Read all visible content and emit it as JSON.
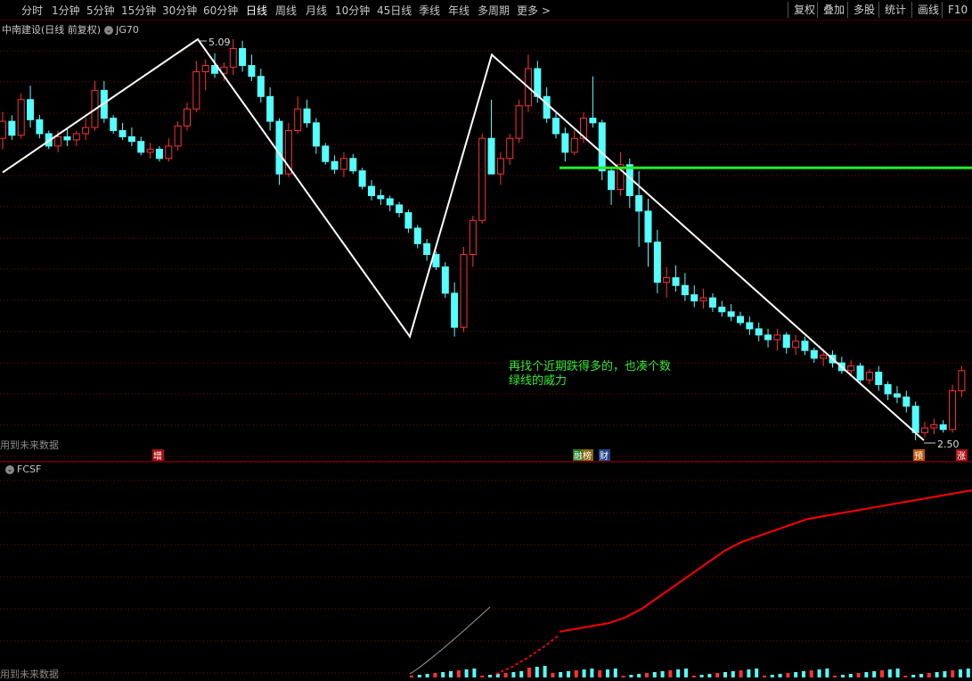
{
  "toolbar": {
    "periods": [
      "分时",
      "1分钟",
      "5分钟",
      "15分钟",
      "30分钟",
      "60分钟",
      "日线",
      "周线",
      "月线",
      "10分钟",
      "45日线",
      "季线",
      "年线",
      "多周期",
      "更多 >"
    ],
    "active_period": "日线",
    "right_buttons": [
      "复权",
      "叠加",
      "多股",
      "统计",
      "画线",
      "F10"
    ]
  },
  "main_chart": {
    "title": "中南建设(日线 前复权)",
    "indicator": "JG70",
    "high_label": "5.09",
    "low_label": "2.50",
    "future_text": "用到未来数据",
    "annotation_line1": "再找个近期跌得多的，也凑个数",
    "annotation_line2": "绿线的威力",
    "event_markers": [
      "增",
      "融",
      "榜",
      "财",
      "预",
      "涨"
    ]
  },
  "indicator_panel": {
    "title": "FCSF",
    "future_text": "用到未来数据"
  },
  "colors": {
    "up": "#ff3232",
    "down": "#54ffff",
    "zigzag": "#ffffff",
    "support_line": "#22ee22",
    "fcsf_line": "#ff0000",
    "grid": "#8b0000"
  },
  "chart_data": {
    "type": "candlestick",
    "price_range": [
      2.5,
      5.09
    ],
    "zigzag_pivots": [
      4.23,
      5.09,
      3.17,
      4.99,
      2.5
    ],
    "support_level": 4.26,
    "candles": [
      [
        4.45,
        4.62,
        4.38,
        4.56
      ],
      [
        4.56,
        4.6,
        4.44,
        4.47
      ],
      [
        4.47,
        4.74,
        4.45,
        4.7
      ],
      [
        4.7,
        4.79,
        4.52,
        4.57
      ],
      [
        4.57,
        4.6,
        4.45,
        4.48
      ],
      [
        4.48,
        4.5,
        4.38,
        4.4
      ],
      [
        4.4,
        4.5,
        4.36,
        4.46
      ],
      [
        4.46,
        4.52,
        4.4,
        4.44
      ],
      [
        4.44,
        4.5,
        4.4,
        4.48
      ],
      [
        4.48,
        4.58,
        4.44,
        4.52
      ],
      [
        4.52,
        4.82,
        4.5,
        4.76
      ],
      [
        4.76,
        4.82,
        4.55,
        4.58
      ],
      [
        4.58,
        4.6,
        4.48,
        4.5
      ],
      [
        4.5,
        4.55,
        4.44,
        4.46
      ],
      [
        4.46,
        4.52,
        4.4,
        4.43
      ],
      [
        4.43,
        4.46,
        4.34,
        4.36
      ],
      [
        4.36,
        4.42,
        4.32,
        4.38
      ],
      [
        4.38,
        4.4,
        4.3,
        4.32
      ],
      [
        4.32,
        4.45,
        4.3,
        4.4
      ],
      [
        4.4,
        4.56,
        4.37,
        4.53
      ],
      [
        4.53,
        4.68,
        4.5,
        4.64
      ],
      [
        4.64,
        4.95,
        4.62,
        4.88
      ],
      [
        4.88,
        4.96,
        4.76,
        4.92
      ],
      [
        4.92,
        5.0,
        4.84,
        4.87
      ],
      [
        4.87,
        4.94,
        4.82,
        4.91
      ],
      [
        4.91,
        5.09,
        4.86,
        5.03
      ],
      [
        5.03,
        5.08,
        4.88,
        4.92
      ],
      [
        4.92,
        4.99,
        4.82,
        4.85
      ],
      [
        4.85,
        4.9,
        4.68,
        4.72
      ],
      [
        4.72,
        4.78,
        4.5,
        4.56
      ],
      [
        4.56,
        4.58,
        4.15,
        4.22
      ],
      [
        4.22,
        4.55,
        4.2,
        4.5
      ],
      [
        4.5,
        4.72,
        4.48,
        4.64
      ],
      [
        4.64,
        4.7,
        4.52,
        4.55
      ],
      [
        4.55,
        4.58,
        4.35,
        4.4
      ],
      [
        4.4,
        4.42,
        4.28,
        4.3
      ],
      [
        4.3,
        4.34,
        4.22,
        4.25
      ],
      [
        4.25,
        4.36,
        4.2,
        4.32
      ],
      [
        4.32,
        4.35,
        4.22,
        4.24
      ],
      [
        4.24,
        4.26,
        4.12,
        4.14
      ],
      [
        4.14,
        4.18,
        4.05,
        4.08
      ],
      [
        4.08,
        4.12,
        4.02,
        4.06
      ],
      [
        4.06,
        4.08,
        3.98,
        4.02
      ],
      [
        4.02,
        4.04,
        3.94,
        3.97
      ],
      [
        3.97,
        3.99,
        3.84,
        3.87
      ],
      [
        3.87,
        3.89,
        3.74,
        3.77
      ],
      [
        3.77,
        3.8,
        3.66,
        3.7
      ],
      [
        3.7,
        3.72,
        3.6,
        3.62
      ],
      [
        3.62,
        3.65,
        3.42,
        3.45
      ],
      [
        3.45,
        3.52,
        3.17,
        3.23
      ],
      [
        3.23,
        3.75,
        3.2,
        3.7
      ],
      [
        3.7,
        3.95,
        3.62,
        3.92
      ],
      [
        3.92,
        4.48,
        3.9,
        4.45
      ],
      [
        4.45,
        4.7,
        4.38,
        4.22
      ],
      [
        4.22,
        4.36,
        4.15,
        4.32
      ],
      [
        4.32,
        4.48,
        4.28,
        4.45
      ],
      [
        4.45,
        4.7,
        4.42,
        4.66
      ],
      [
        4.66,
        4.99,
        4.62,
        4.9
      ],
      [
        4.9,
        4.95,
        4.68,
        4.72
      ],
      [
        4.72,
        4.78,
        4.55,
        4.58
      ],
      [
        4.58,
        4.62,
        4.45,
        4.48
      ],
      [
        4.48,
        4.52,
        4.3,
        4.36
      ],
      [
        4.36,
        4.5,
        4.34,
        4.45
      ],
      [
        4.45,
        4.62,
        4.42,
        4.58
      ],
      [
        4.58,
        4.85,
        4.52,
        4.55
      ],
      [
        4.55,
        4.57,
        4.18,
        4.24
      ],
      [
        4.24,
        4.26,
        4.02,
        4.12
      ],
      [
        4.12,
        4.36,
        4.08,
        4.28
      ],
      [
        4.28,
        4.32,
        4.0,
        4.08
      ],
      [
        4.08,
        4.24,
        3.75,
        3.98
      ],
      [
        3.98,
        4.06,
        3.62,
        3.78
      ],
      [
        3.78,
        3.86,
        3.45,
        3.52
      ],
      [
        3.52,
        3.62,
        3.42,
        3.55
      ],
      [
        3.55,
        3.63,
        3.46,
        3.5
      ],
      [
        3.5,
        3.58,
        3.4,
        3.44
      ],
      [
        3.44,
        3.5,
        3.36,
        3.4
      ],
      [
        3.4,
        3.48,
        3.35,
        3.42
      ],
      [
        3.42,
        3.45,
        3.33,
        3.36
      ],
      [
        3.36,
        3.4,
        3.3,
        3.33
      ],
      [
        3.33,
        3.38,
        3.27,
        3.3
      ],
      [
        3.3,
        3.33,
        3.24,
        3.26
      ],
      [
        3.26,
        3.3,
        3.18,
        3.22
      ],
      [
        3.22,
        3.26,
        3.14,
        3.18
      ],
      [
        3.18,
        3.22,
        3.1,
        3.15
      ],
      [
        3.15,
        3.22,
        3.08,
        3.18
      ],
      [
        3.18,
        3.2,
        3.06,
        3.1
      ],
      [
        3.1,
        3.18,
        3.05,
        3.14
      ],
      [
        3.14,
        3.17,
        3.05,
        3.08
      ],
      [
        3.08,
        3.1,
        3.0,
        3.03
      ],
      [
        3.03,
        3.08,
        2.98,
        3.05
      ],
      [
        3.05,
        3.08,
        2.97,
        3.0
      ],
      [
        3.0,
        3.04,
        2.93,
        2.95
      ],
      [
        2.95,
        3.02,
        2.92,
        2.98
      ],
      [
        2.98,
        3.0,
        2.86,
        2.89
      ],
      [
        2.89,
        2.96,
        2.86,
        2.94
      ],
      [
        2.94,
        2.98,
        2.82,
        2.86
      ],
      [
        2.86,
        2.88,
        2.76,
        2.8
      ],
      [
        2.8,
        2.85,
        2.74,
        2.78
      ],
      [
        2.78,
        2.82,
        2.68,
        2.72
      ],
      [
        2.72,
        2.75,
        2.5,
        2.55
      ],
      [
        2.55,
        2.62,
        2.52,
        2.58
      ],
      [
        2.58,
        2.64,
        2.54,
        2.6
      ],
      [
        2.6,
        2.63,
        2.55,
        2.57
      ],
      [
        2.57,
        2.86,
        2.55,
        2.82
      ],
      [
        2.82,
        2.98,
        2.78,
        2.95
      ]
    ],
    "fcsf_series": [
      0.02,
      0.04,
      0.06,
      0.08,
      0.12,
      0.18,
      0.26,
      0.34,
      0.42,
      0.5,
      0.58,
      0.64,
      0.68,
      0.72,
      0.76,
      0.8,
      0.82,
      0.84,
      0.86,
      0.88,
      0.9,
      0.92,
      0.94,
      0.96,
      0.98,
      1.0
    ]
  }
}
